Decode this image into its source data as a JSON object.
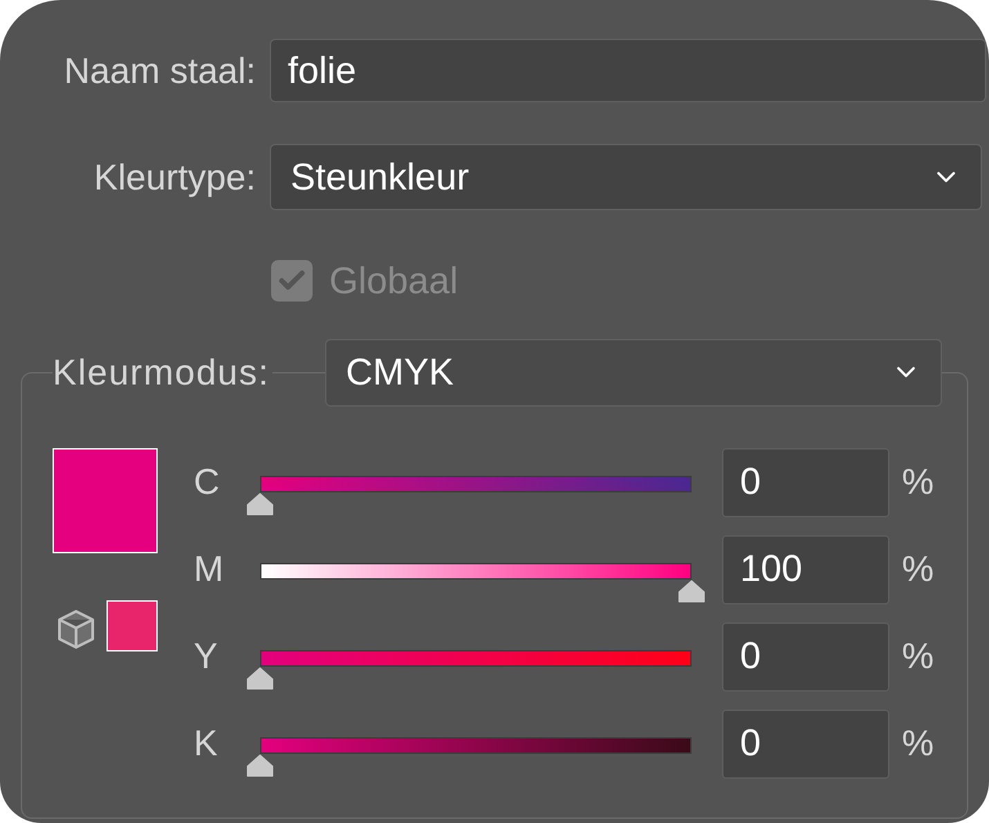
{
  "name_field": {
    "label": "Naam staal:",
    "value": "folie"
  },
  "color_type": {
    "label": "Kleurtype:",
    "value": "Steunkleur"
  },
  "global_checkbox": {
    "label": "Globaal",
    "checked": true,
    "disabled": true
  },
  "color_mode": {
    "label": "Kleurmodus:",
    "value": "CMYK"
  },
  "swatches": [
    {
      "kind": "main",
      "color": "#e4007e"
    },
    {
      "kind": "gamut",
      "color": "#e8246a"
    }
  ],
  "channels": [
    {
      "name": "C",
      "kind": "tint",
      "level": 0,
      "value": "0",
      "unit": "%",
      "color": "#4a2890"
    },
    {
      "name": "M",
      "kind": "fade",
      "level": 1,
      "value": "100",
      "unit": "%",
      "color": "#ff0080"
    },
    {
      "name": "Y",
      "kind": "tint",
      "level": 0,
      "value": "0",
      "unit": "%",
      "color": "#ff0018"
    },
    {
      "name": "K",
      "kind": "tint",
      "level": 0,
      "value": "0",
      "unit": "%",
      "color": "#3a0a18"
    }
  ]
}
